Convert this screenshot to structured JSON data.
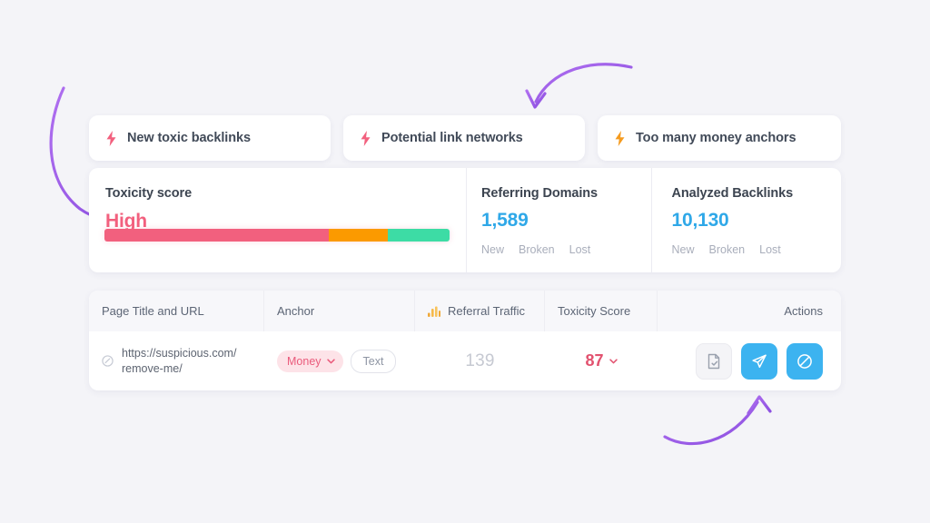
{
  "alerts": {
    "cards": [
      {
        "label": "New toxic backlinks",
        "icon": "bolt-icon",
        "icon_color": "#f2607e"
      },
      {
        "label": "Potential link networks",
        "icon": "bolt-icon",
        "icon_color": "#f2607e"
      },
      {
        "label": "Too many money anchors",
        "icon": "bolt-icon",
        "icon_color": "#f59b1f"
      }
    ]
  },
  "summary": {
    "toxicity": {
      "title": "Toxicity score",
      "value": "High",
      "value_color": "#f2607e",
      "bar": {
        "segments": [
          {
            "name": "high",
            "color": "#f2607e",
            "percent": 65
          },
          {
            "name": "medium",
            "color": "#fb9a00",
            "percent": 17
          },
          {
            "name": "low",
            "color": "#3ddca5",
            "percent": 18
          }
        ]
      }
    },
    "stats": [
      {
        "title": "Referring Domains",
        "value": "1,589",
        "value_color": "#2fa8e8",
        "sublinks": [
          "New",
          "Broken",
          "Lost"
        ]
      },
      {
        "title": "Analyzed Backlinks",
        "value": "10,130",
        "value_color": "#2fa8e8",
        "sublinks": [
          "New",
          "Broken",
          "Lost"
        ]
      }
    ]
  },
  "table": {
    "columns": [
      {
        "label": "Page Title and URL",
        "icon": null
      },
      {
        "label": "Anchor",
        "icon": null
      },
      {
        "label": "Referral Traffic",
        "icon": "bar-chart-icon"
      },
      {
        "label": "Toxicity Score",
        "icon": null
      },
      {
        "label": "Actions",
        "icon": null
      }
    ],
    "rows": [
      {
        "url_line1": "https://suspicious.com/",
        "url_line2": "remove-me/",
        "url_icon": "link-icon",
        "anchor_primary": "Money",
        "anchor_secondary": "Text",
        "referral_traffic": "139",
        "toxicity_score": "87",
        "toxicity_color": "#e2526f",
        "actions": [
          {
            "name": "whitelist-button",
            "icon": "document-check-icon",
            "style": "light"
          },
          {
            "name": "send-button",
            "icon": "send-icon",
            "style": "blue"
          },
          {
            "name": "disavow-button",
            "icon": "ban-icon",
            "style": "blue"
          }
        ]
      }
    ]
  },
  "annotations": {
    "arrow_color": "#a259e6",
    "arrows": [
      {
        "name": "arrow-to-toxicity-score",
        "points_to": "Toxicity score"
      },
      {
        "name": "arrow-to-potential-link-networks",
        "points_to": "Potential link networks"
      },
      {
        "name": "arrow-to-actions",
        "points_to": "Actions"
      }
    ]
  }
}
